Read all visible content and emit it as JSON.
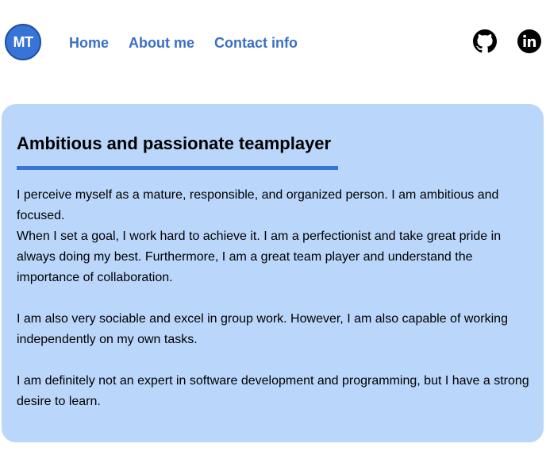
{
  "header": {
    "logo_text": "MT",
    "nav": [
      {
        "label": "Home"
      },
      {
        "label": "About me"
      },
      {
        "label": "Contact info"
      }
    ],
    "social_icons": [
      "github-icon",
      "linkedin-icon"
    ]
  },
  "main": {
    "title": "Ambitious and passionate teamplayer",
    "paragraphs": [
      "I perceive myself as a mature, responsible, and organized person. I am ambitious and focused.",
      "When I set a goal, I work hard to achieve it. I am a perfectionist and take great pride in always doing my best. Furthermore, I am a great team player and understand the importance of collaboration.",
      "I am also very sociable and excel in group work. However, I am also capable of working independently on my own tasks.",
      "I am definitely not an expert in software development and programming, but I have a strong desire to learn."
    ]
  },
  "colors": {
    "accent": "#3874d8",
    "nav_link": "#3a6fc4",
    "card_bg": "#bad6fb"
  }
}
